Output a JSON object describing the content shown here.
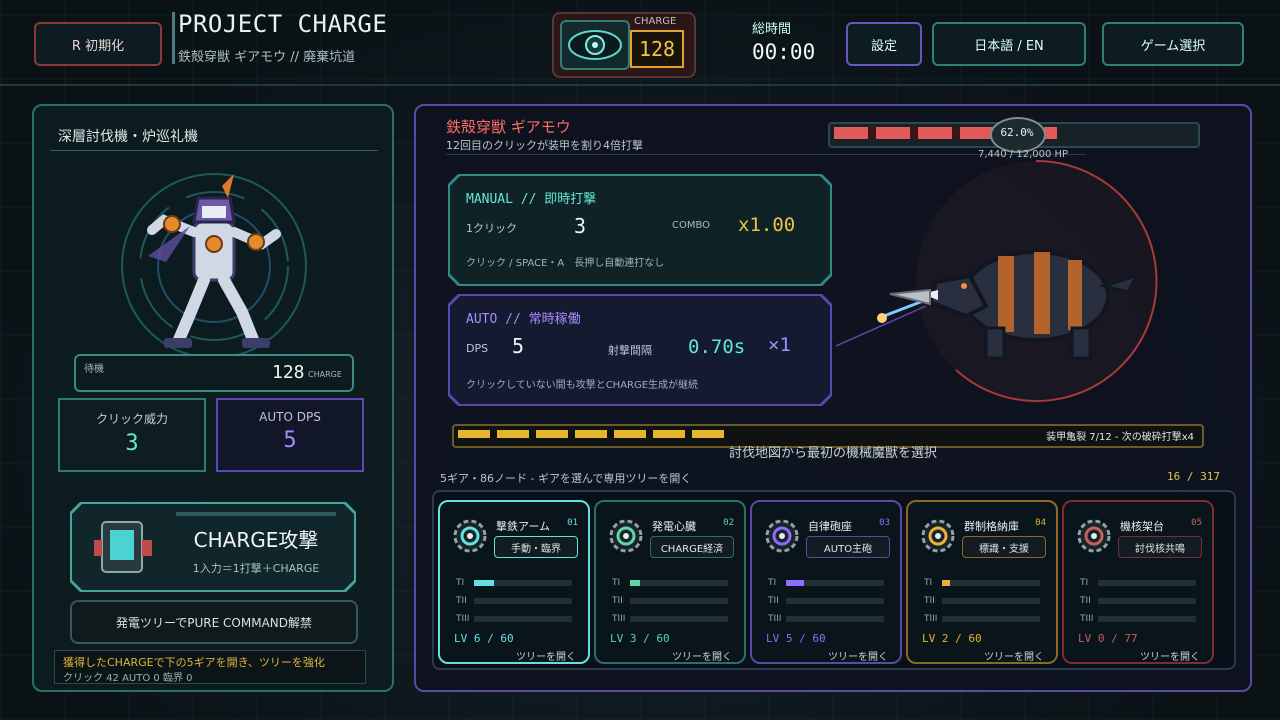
{
  "header": {
    "reset_label": "R 初期化",
    "title": "PROJECT CHARGE",
    "subtitle": "鉄殻穿獣 ギアモウ // 廃棄坑道",
    "charge_label": "CHARGE",
    "charge_value": "128",
    "time_label": "総時間",
    "time_value": "00:00",
    "settings_label": "設定",
    "language_label": "日本語 / EN",
    "game_select_label": "ゲーム選択"
  },
  "left": {
    "title": "深層討伐機・炉巡礼機",
    "status_label": "待機",
    "charge_value": "128",
    "charge_unit": "CHARGE",
    "click_power_label": "クリック威力",
    "click_power_value": "3",
    "auto_dps_label": "AUTO DPS",
    "auto_dps_value": "5",
    "charge_attack_title": "CHARGE攻撃",
    "charge_attack_desc": "1入力＝1打撃＋CHARGE",
    "unlock_button": "発電ツリーでPURE COMMAND解禁",
    "hint_text": "獲得したCHARGEで下の5ギアを開き、ツリーを強化",
    "stats_text": "クリック 42 AUTO 0 臨界 0"
  },
  "main": {
    "enemy_name": "鉄殻穿獣 ギアモウ",
    "enemy_desc": "12回目のクリックが装甲を割り4倍打撃",
    "hp_percent_label": "62.0%",
    "hp_fraction": 0.62,
    "hp_text": "7,440 / 12,000 HP",
    "manual": {
      "title": "MANUAL // 即時打撃",
      "click_label": "1クリック",
      "click_value": "3",
      "combo_label": "COMBO",
      "combo_value": "x1.00",
      "desc": "クリック / SPACE・A　長押し自動連打なし"
    },
    "auto": {
      "title": "AUTO // 常時稼働",
      "dps_label": "DPS",
      "dps_value": "5",
      "interval_label": "射撃間隔",
      "interval_value": "0.70s",
      "mult_value": "×1",
      "desc": "クリックしていない間も攻撃とCHARGE生成が継続"
    },
    "armor_crack_text": "装甲亀裂 7/12 - 次の破砕打撃x4",
    "armor_crack_filled": 7,
    "armor_crack_total": 12,
    "map_prompt": "討伐地図から最初の機械魔獣を選択",
    "gears_header": "5ギア・86ノード - ギアを選んで専用ツリーを開く",
    "gears_progress": "16 / 317",
    "gears": [
      {
        "name": "撃鉄アーム",
        "num": "01",
        "tag": "手動・臨界",
        "lv": "LV 6 / 60",
        "open": "ツリーを開く",
        "t1": 0.2,
        "t2": 0,
        "t3": 0,
        "color": "#63e0e0",
        "border": "#63e0e0",
        "icon": "gear-arm-icon"
      },
      {
        "name": "発電心臓",
        "num": "02",
        "tag": "CHARGE経済",
        "lv": "LV 3 / 60",
        "open": "ツリーを開く",
        "t1": 0.1,
        "t2": 0,
        "t3": 0,
        "color": "#5ed6a8",
        "border": "#2b6f6a",
        "icon": "gear-heart-icon"
      },
      {
        "name": "自律砲座",
        "num": "03",
        "tag": "AUTO主砲",
        "lv": "LV 5 / 60",
        "open": "ツリーを開く",
        "t1": 0.18,
        "t2": 0,
        "t3": 0,
        "color": "#8f6bff",
        "border": "#5a4aa5",
        "icon": "gear-turret-icon"
      },
      {
        "name": "群制格納庫",
        "num": "04",
        "tag": "標識・支援",
        "lv": "LV 2 / 60",
        "open": "ツリーを開く",
        "t1": 0.08,
        "t2": 0,
        "t3": 0,
        "color": "#e8b23a",
        "border": "#8a6a24",
        "icon": "gear-hangar-icon"
      },
      {
        "name": "機核架台",
        "num": "05",
        "tag": "討伐核共鳴",
        "lv": "LV 0 / 77",
        "open": "ツリーを開く",
        "t1": 0,
        "t2": 0,
        "t3": 0,
        "color": "#c46060",
        "border": "#7a2e32",
        "icon": "gear-core-icon"
      }
    ],
    "tier_labels": [
      "TI",
      "TII",
      "TIII"
    ]
  }
}
